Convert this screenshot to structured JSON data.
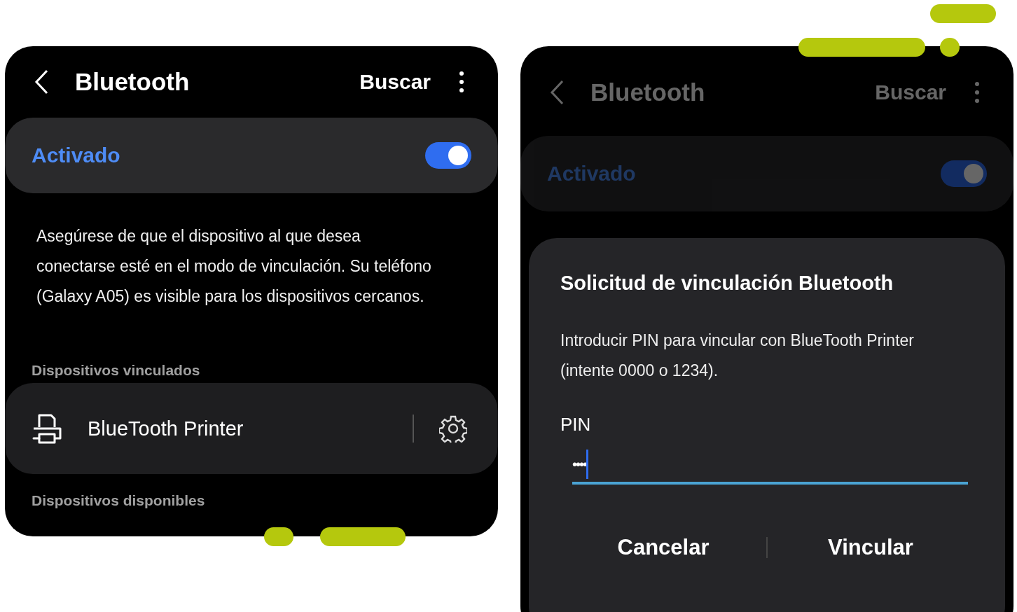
{
  "left_screen": {
    "header": {
      "title": "Bluetooth",
      "action": "Buscar"
    },
    "master_switch": {
      "label": "Activado",
      "on": true
    },
    "description": "Asegúrese de que el dispositivo al que desea conectarse esté en el modo de vinculación. Su teléfono (Galaxy A05) es visible para los dispositivos cercanos.",
    "sections": [
      {
        "heading": "Dispositivos vinculados",
        "devices": [
          {
            "name": "BlueTooth Printer"
          }
        ]
      },
      {
        "heading": "Dispositivos disponibles"
      }
    ]
  },
  "right_screen": {
    "dimmed": true,
    "header": {
      "title": "Bluetooth",
      "action": "Buscar"
    },
    "master_switch": {
      "label": "Activado",
      "on": true
    },
    "dialog": {
      "title": "Solicitud de vinculación Bluetooth",
      "message": "Introducir PIN para vincular con BlueTooth Printer (intente 0000 o 1234).",
      "field_label": "PIN",
      "value": "••••",
      "buttons": [
        "Cancelar",
        "Vincular"
      ]
    }
  }
}
